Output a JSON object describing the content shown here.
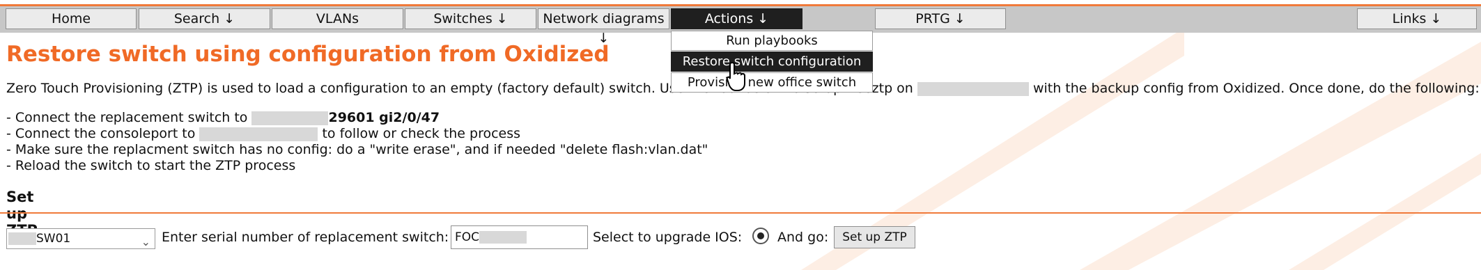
{
  "nav": {
    "home": "Home",
    "search": "Search ↓",
    "vlans": "VLANs",
    "switches": "Switches ↓",
    "network_diagrams": "Network diagrams ↓",
    "actions": "Actions ↓",
    "prtg": "PRTG ↓",
    "links": "Links ↓"
  },
  "actions_menu": [
    "Run playbooks",
    "Restore switch configuration",
    "Provision new office switch"
  ],
  "page": {
    "title": "Restore switch using configuration from Oxidized",
    "intro_a": "Zero Touch Provisioning (ZTP) is used to load a configuration to an empty (factory default) switch. Use the tool below to setup freeztp on",
    "intro_b": "with the backup config from Oxidized. Once done, do the following:",
    "step1_a": "- Connect the replacement switch to",
    "step1_b": "29601 gi2/0/47",
    "step2_a": "- Connect the consoleport to",
    "step2_b": "to follow or check the process",
    "step3": "- Make sure the replacment switch has no config: do a \"write erase\", and if needed \"delete flash:vlan.dat\"",
    "step4": "- Reload the switch to start the ZTP process"
  },
  "ztp": {
    "section_title": "Set up ZTP",
    "switch_select_value": "SW01",
    "serial_label": "Enter serial number of replacement switch:",
    "serial_value": "FOC",
    "upgrade_label": "Select to upgrade IOS:",
    "go_label": "And go:",
    "submit_label": "Set up ZTP"
  },
  "colors": {
    "accent": "#f06a26",
    "nav_active": "#1f1f1f",
    "navbar_bg": "#c7c7c7"
  }
}
